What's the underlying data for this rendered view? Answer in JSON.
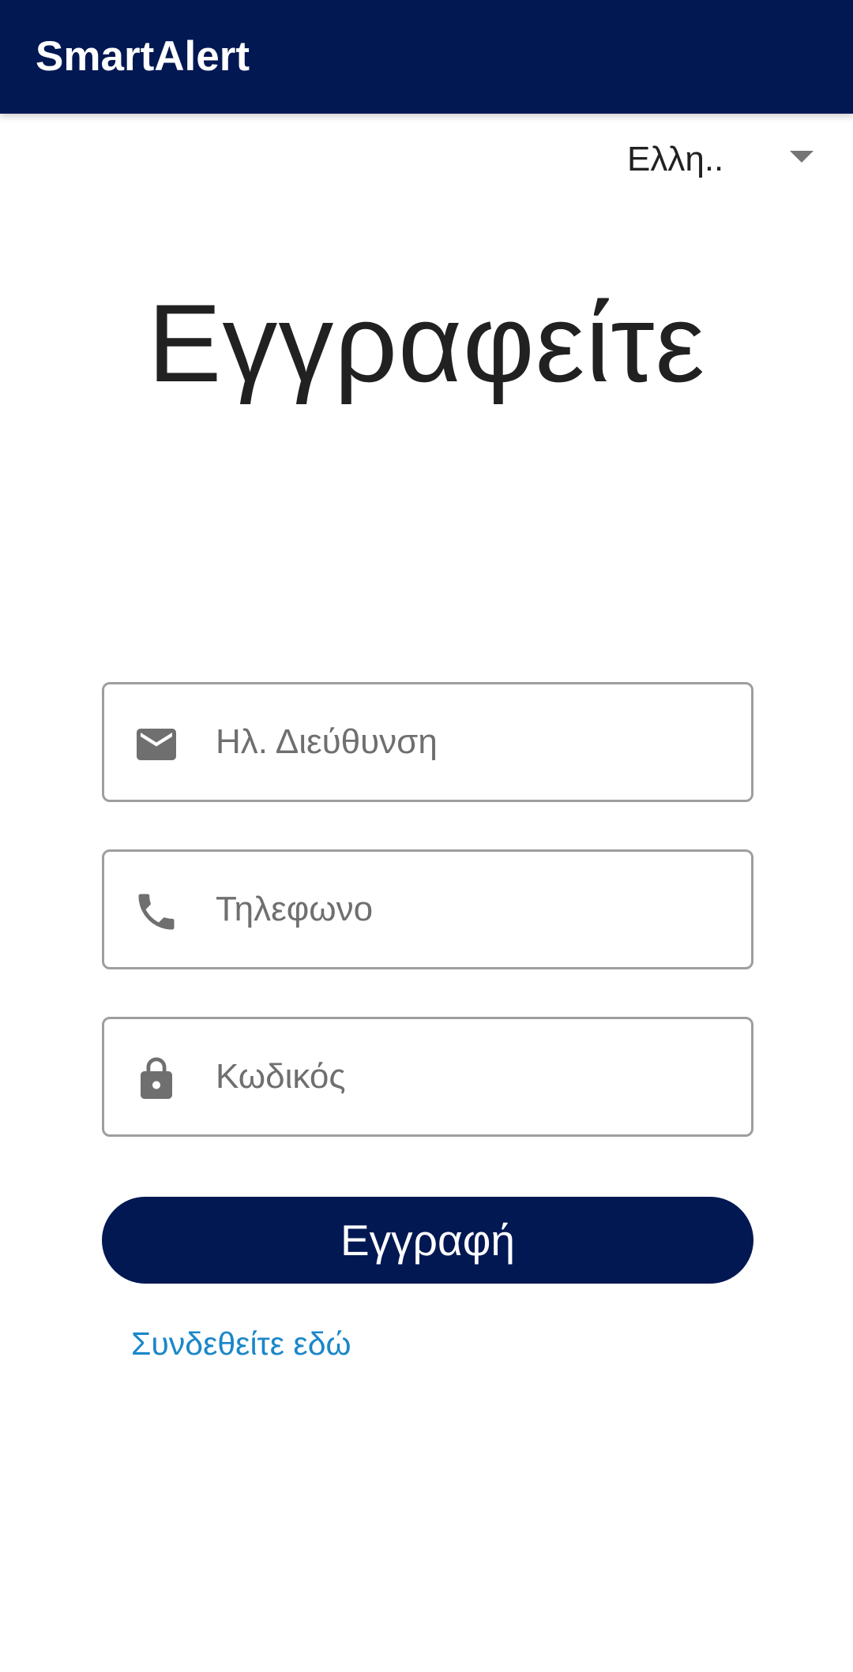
{
  "app_bar": {
    "title": "SmartAlert",
    "color": "#021853"
  },
  "language_selector": {
    "selected": "Ελλη..",
    "icon": "dropdown-arrow-icon"
  },
  "page": {
    "title": "Εγγραφείτε"
  },
  "form": {
    "email": {
      "placeholder": "Ηλ. Διεύθυνση",
      "value": "",
      "icon": "email-icon"
    },
    "phone": {
      "placeholder": "Τηλεφωνο",
      "value": "",
      "icon": "phone-icon"
    },
    "password": {
      "placeholder": "Κωδικός",
      "value": "",
      "icon": "lock-icon"
    },
    "submit_label": "Εγγραφή",
    "login_link": "Συνδεθείτε εδώ"
  },
  "colors": {
    "primary": "#021853",
    "link": "#1a87c9",
    "icon": "#6f6f6f",
    "field_border": "#9e9e9e"
  }
}
